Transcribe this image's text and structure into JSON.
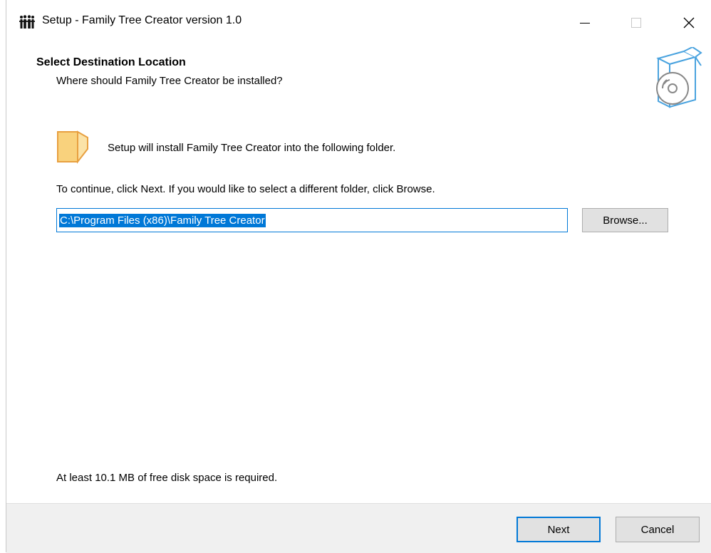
{
  "window": {
    "title": "Setup - Family Tree Creator version 1.0",
    "icon": "family-icon",
    "controls": {
      "minimize": "minimize-icon",
      "maximize": "maximize-icon",
      "close": "close-icon"
    }
  },
  "header": {
    "title": "Select Destination Location",
    "subtitle": "Where should Family Tree Creator be installed?",
    "image": "install-box-disc-icon"
  },
  "body": {
    "folder_icon": "folder-icon",
    "folder_text": "Setup will install Family Tree Creator into the following folder.",
    "continue_text": "To continue, click Next. If you would like to select a different folder, click Browse.",
    "path_value": "C:\\Program Files (x86)\\Family Tree Creator",
    "browse_label": "Browse...",
    "disk_space_text": "At least 10.1 MB of free disk space is required."
  },
  "footer": {
    "next_label": "Next",
    "cancel_label": "Cancel"
  },
  "colors": {
    "accent": "#0078d7",
    "button_face": "#e1e1e1",
    "footer_bg": "#f0f0f0",
    "folder_fill": "#f9d27d",
    "folder_outline": "#e8a040",
    "box_outline": "#4aa3df"
  }
}
